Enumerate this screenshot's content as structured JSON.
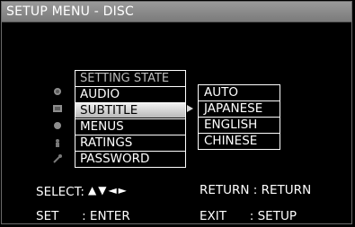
{
  "title": "SETUP MENU - DISC",
  "menu": {
    "header": "SETTING STATE",
    "items": [
      {
        "label": "AUDIO",
        "icon": "speaker-icon"
      },
      {
        "label": "SUBTITLE",
        "icon": "subtitle-icon",
        "selected": true
      },
      {
        "label": "MENUS",
        "icon": "disc-menu-icon"
      },
      {
        "label": "RATINGS",
        "icon": "ratings-icon"
      },
      {
        "label": "PASSWORD",
        "icon": "key-icon"
      }
    ]
  },
  "submenu": {
    "options": [
      "AUTO",
      "JAPANESE",
      "ENGLISH",
      "CHINESE"
    ]
  },
  "footer": {
    "select_label": "SELECT:",
    "select_arrows": "▲▼◄►",
    "return_label": "RETURN : RETURN",
    "set_label": "SET      : ENTER",
    "exit_label": "EXIT      : SETUP"
  },
  "colors": {
    "title_bar": "#8a8a8a",
    "selected_item": "#d0d0d0",
    "background": "#000000"
  }
}
